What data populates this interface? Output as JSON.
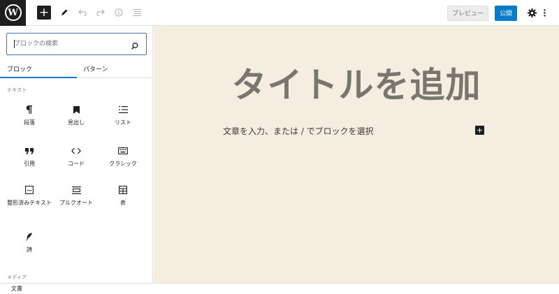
{
  "toolbar": {
    "logo_letter": "W",
    "add_label": "+",
    "preview_label": "プレビュー",
    "publish_label": "公開",
    "accent_color": "#0a7bc4"
  },
  "inserter": {
    "search_placeholder": "ブロックの検索",
    "tabs": {
      "blocks": "ブロック",
      "patterns": "パターン"
    },
    "categories": {
      "text": "テキスト",
      "media": "メディア"
    },
    "blocks": [
      {
        "label": "段落",
        "icon": "paragraph-icon"
      },
      {
        "label": "見出し",
        "icon": "bookmark-icon"
      },
      {
        "label": "リスト",
        "icon": "list-icon"
      },
      {
        "label": "引用",
        "icon": "quote-icon"
      },
      {
        "label": "コード",
        "icon": "code-icon"
      },
      {
        "label": "クラシック",
        "icon": "keyboard-icon"
      },
      {
        "label": "整形済みテキスト",
        "icon": "preformatted-icon"
      },
      {
        "label": "プルクオート",
        "icon": "pullquote-icon"
      },
      {
        "label": "表",
        "icon": "table-icon"
      },
      {
        "label": "詩",
        "icon": "feather-icon"
      }
    ]
  },
  "editor": {
    "title_placeholder": "タイトルを追加",
    "paragraph_placeholder": "文章を入力、または / でブロックを選択",
    "inline_add_label": "+",
    "canvas_color": "#f4ede0"
  },
  "footer": {
    "breadcrumb": "文書"
  }
}
